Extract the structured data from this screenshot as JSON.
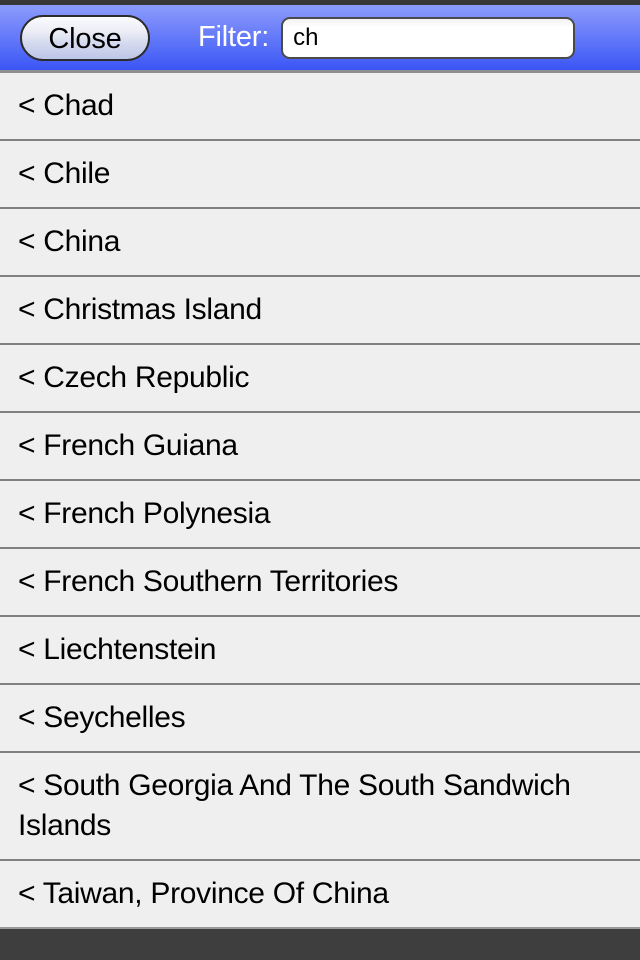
{
  "toolbar": {
    "close_label": "Close",
    "filter_label": "Filter:",
    "filter_value": "ch",
    "filter_placeholder": "",
    "bar_color_top": "#8c9cfc",
    "bar_color_bottom": "#3b55f5",
    "label_color": "#ffffff"
  },
  "list": {
    "prefix": "< ",
    "row_background": "#efefef",
    "separator_color": "#808080",
    "text_color": "#000000",
    "items": [
      {
        "label": "Chad"
      },
      {
        "label": "Chile"
      },
      {
        "label": "China"
      },
      {
        "label": "Christmas Island"
      },
      {
        "label": "Czech Republic"
      },
      {
        "label": "French Guiana"
      },
      {
        "label": "French Polynesia"
      },
      {
        "label": "French Southern Territories"
      },
      {
        "label": "Liechtenstein"
      },
      {
        "label": "Seychelles"
      },
      {
        "label": "South Georgia And The South Sandwich Islands"
      },
      {
        "label": "Taiwan, Province Of China"
      }
    ]
  },
  "bottom": {
    "background_color": "#3e3e3e"
  }
}
